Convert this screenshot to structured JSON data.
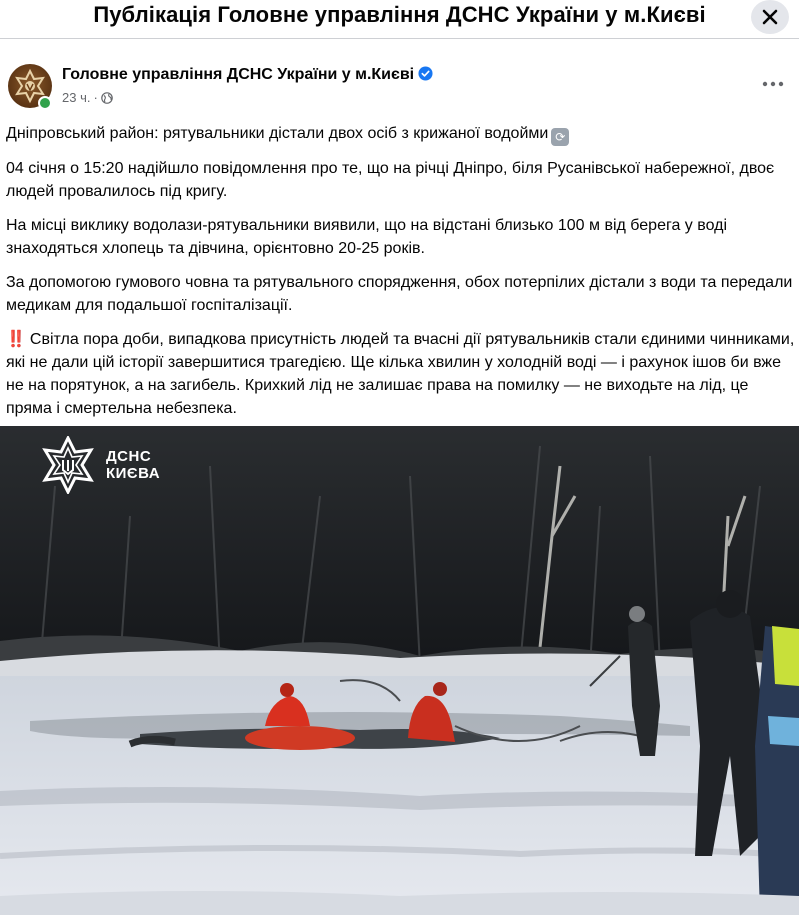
{
  "topbar": {
    "title": "Публікація Головне управління ДСНС України у м.Києві"
  },
  "post": {
    "author": "Головне управління ДСНС України у м.Києві",
    "time": "23 ч.",
    "paragraphs": {
      "p1": "Дніпровський район: рятувальники дістали двох осіб з крижаної водойми",
      "p2": "04 січня о 15:20 надійшло повідомлення про те, що на річці Дніпро, біля Русанівської набережної, двоє людей провалилось під кригу.",
      "p3": "На місці виклику водолази-рятувальники виявили, що на відстані близько 100 м від берега у воді знаходяться хлопець та дівчина, орієнтовно 20-25 років.",
      "p4": "За допомогою гумового човна та рятувального спорядження, обох потерпілих дістали з води та передали медикам для подальшої госпіталізації.",
      "p5": "Світла пора доби, випадкова присутність людей та вчасні дії рятувальників стали єдиними чинниками, які не дали цій історії завершитися трагедією. Ще кілька хвилин у холодній воді — і рахунок ішов би вже не на порятунок, а на загибель. Крихкий лід не залишає права на помилку — не виходьте на лід, це пряма і смертельна небезпека."
    },
    "p5_prefix": "‼️"
  },
  "photo": {
    "watermark_line1": "ДСНС",
    "watermark_line2": "КИЄВА"
  },
  "icons": [
    "close-icon",
    "verified-badge-icon",
    "globe-icon",
    "more-options-icon",
    "dsns-emblem-icon",
    "arrows-emoji-icon"
  ],
  "colors": {
    "accent": "#1877f2",
    "secondary_text": "#65676b",
    "ice": "#dfe3ea",
    "rescuer_suit": "#d9301f"
  }
}
